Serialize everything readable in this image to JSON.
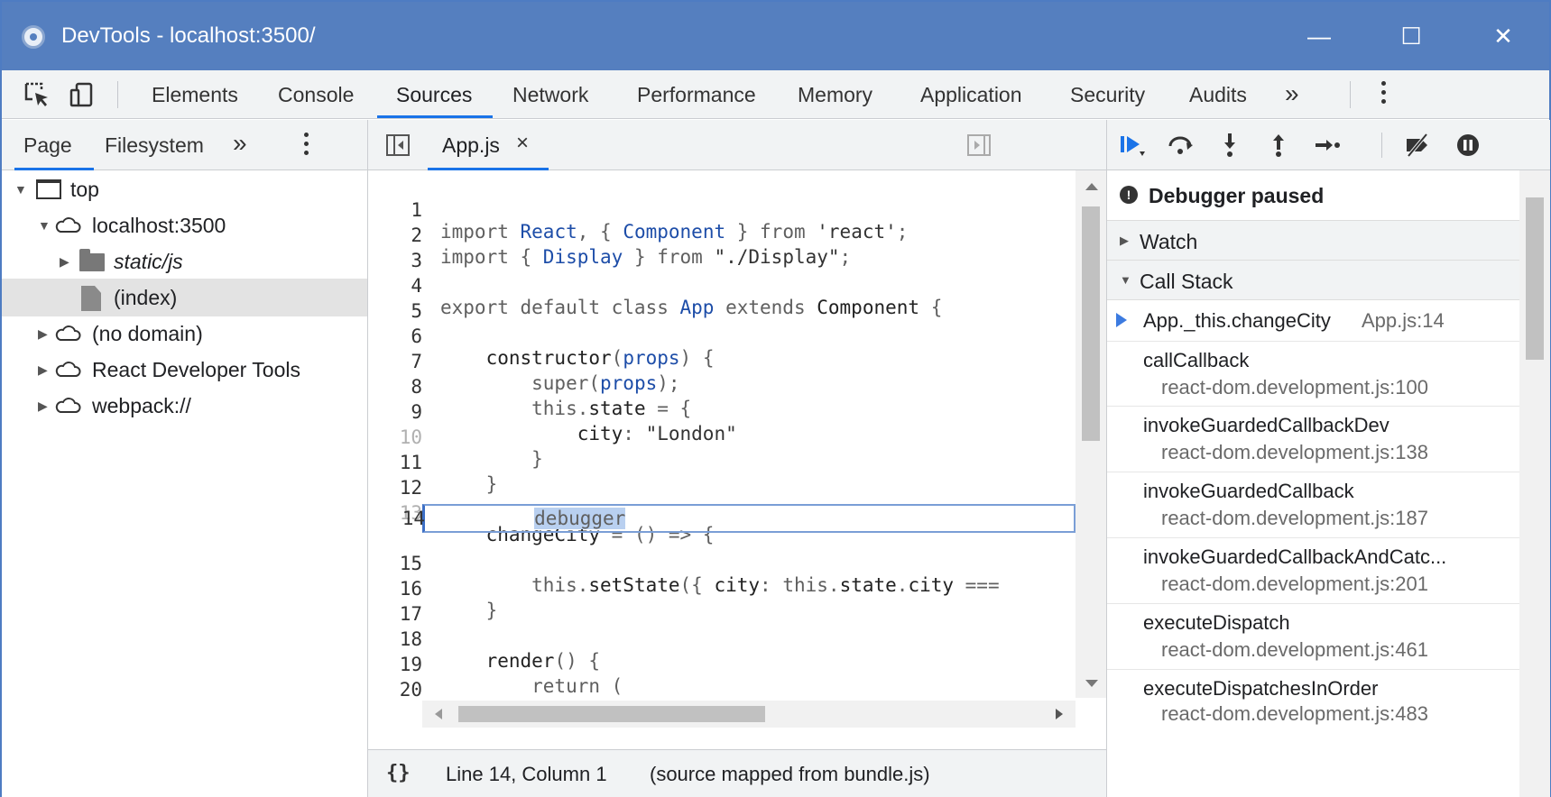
{
  "window": {
    "title": "DevTools - localhost:3500/",
    "minimize": "—",
    "maximize": "☐",
    "close": "✕"
  },
  "main_tabs": {
    "items": [
      "Elements",
      "Console",
      "Sources",
      "Network",
      "Performance",
      "Memory",
      "Application",
      "Security",
      "Audits"
    ],
    "active": "Sources",
    "more": "»"
  },
  "navigator": {
    "tabs": [
      "Page",
      "Filesystem"
    ],
    "more": "»",
    "tree": [
      {
        "label": "top",
        "expanded": true
      },
      {
        "label": "localhost:3500",
        "expanded": true
      },
      {
        "label": "static/js",
        "expanded": false
      },
      {
        "label": "(index)",
        "selected": true
      },
      {
        "label": "(no domain)",
        "expanded": false
      },
      {
        "label": "React Developer Tools",
        "expanded": false
      },
      {
        "label": "webpack://",
        "expanded": false
      }
    ]
  },
  "editor": {
    "tab_label": "App.js",
    "tab_close": "×",
    "current_line": 14,
    "lines": [
      {
        "n": "1",
        "text": "import React, { Component } from 'react';"
      },
      {
        "n": "2",
        "text": "import { Display } from \"./Display\";"
      },
      {
        "n": "3",
        "text": ""
      },
      {
        "n": "4",
        "text": "export default class App extends Component {"
      },
      {
        "n": "5",
        "text": ""
      },
      {
        "n": "6",
        "text": "    constructor(props) {"
      },
      {
        "n": "7",
        "text": "        super(props);"
      },
      {
        "n": "8",
        "text": "        this.state = {"
      },
      {
        "n": "9",
        "text": "            city: \"London\""
      },
      {
        "n": "10",
        "text": "        }"
      },
      {
        "n": "11",
        "text": "    }"
      },
      {
        "n": "12",
        "text": ""
      },
      {
        "n": "13",
        "text": "    changeCity = () => {"
      },
      {
        "n": "14",
        "text": "        debugger"
      },
      {
        "n": "15",
        "text": "        this.setState({ city: this.state.city ==="
      },
      {
        "n": "16",
        "text": "    }"
      },
      {
        "n": "17",
        "text": ""
      },
      {
        "n": "18",
        "text": "    render() {"
      },
      {
        "n": "19",
        "text": "        return ("
      },
      {
        "n": "20",
        "text": ""
      }
    ],
    "status": {
      "pretty_print": "{}",
      "position": "Line 14, Column 1",
      "mapped": "(source mapped from bundle.js)"
    }
  },
  "debugger": {
    "paused_message": "Debugger paused",
    "watch_label": "Watch",
    "call_stack_label": "Call Stack",
    "call_stack": [
      {
        "fn": "App._this.changeCity",
        "loc": "App.js:14",
        "current": true
      },
      {
        "fn": "callCallback",
        "loc": "react-dom.development.js:100"
      },
      {
        "fn": "invokeGuardedCallbackDev",
        "loc": "react-dom.development.js:138"
      },
      {
        "fn": "invokeGuardedCallback",
        "loc": "react-dom.development.js:187"
      },
      {
        "fn": "invokeGuardedCallbackAndCatc...",
        "loc": "react-dom.development.js:201"
      },
      {
        "fn": "executeDispatch",
        "loc": "react-dom.development.js:461"
      },
      {
        "fn": "executeDispatchesInOrder",
        "loc": "react-dom.development.js:483"
      }
    ]
  },
  "colors": {
    "titlebar": "#557fbf",
    "accent": "#1a73e8",
    "identifier": "#1d4da8"
  }
}
